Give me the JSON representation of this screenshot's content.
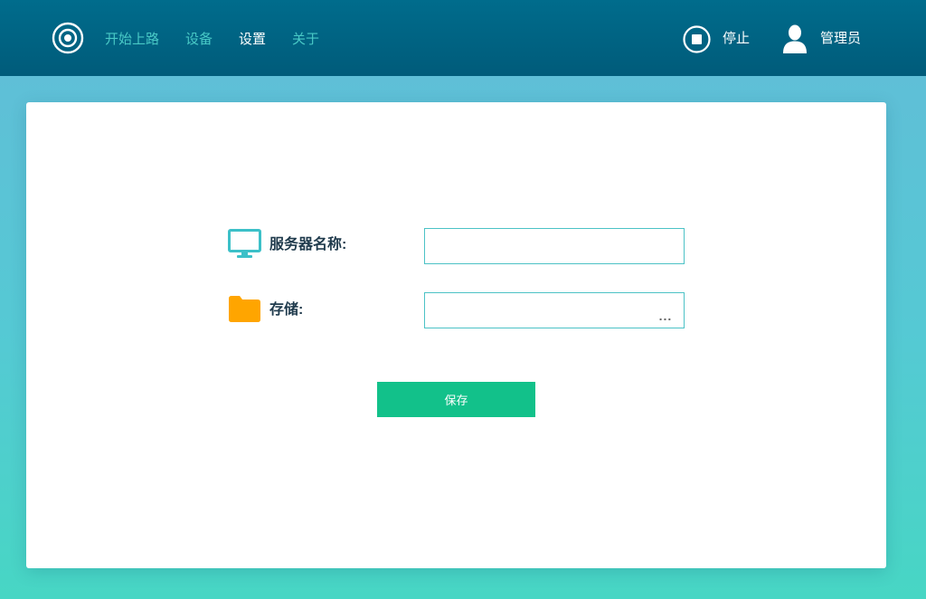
{
  "header": {
    "nav": [
      {
        "label": "开始上路",
        "active": false
      },
      {
        "label": "设备",
        "active": false
      },
      {
        "label": "设置",
        "active": true
      },
      {
        "label": "关于",
        "active": false
      }
    ],
    "stop_label": "停止",
    "user_label": "管理员"
  },
  "form": {
    "server_name": {
      "label": "服务器名称:",
      "value": "",
      "icon": "monitor-icon"
    },
    "storage": {
      "label": "存储:",
      "value": "",
      "icon": "folder-icon",
      "browse_label": "..."
    },
    "save_label": "保存"
  },
  "colors": {
    "header_bg": "#006c8c",
    "nav_inactive": "#49c9c6",
    "nav_active": "#ffffff",
    "accent_teal": "#4cc2c6",
    "folder": "#ffa500",
    "save_button": "#12c18a"
  }
}
